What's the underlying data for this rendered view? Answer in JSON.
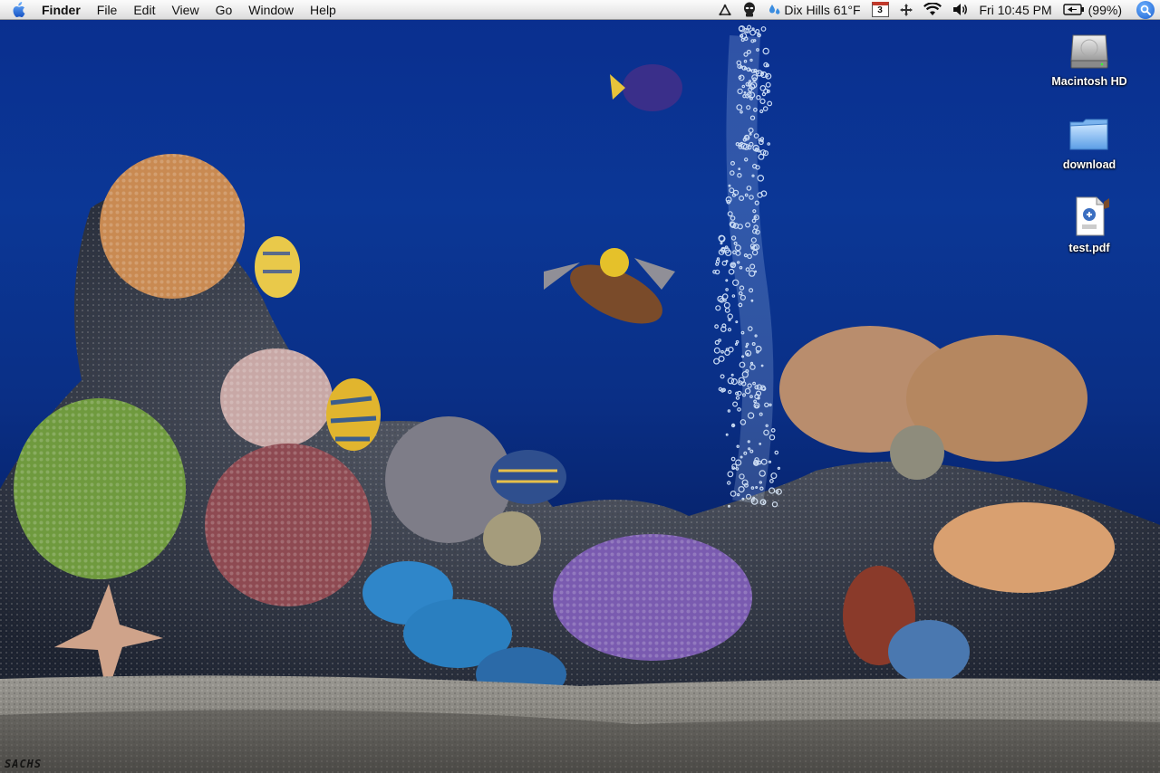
{
  "menubar": {
    "app_name": "Finder",
    "menus": [
      "File",
      "Edit",
      "View",
      "Go",
      "Window",
      "Help"
    ],
    "status": {
      "weather": "Dix Hills 61°F",
      "calendar_day": "3",
      "clock": "Fri 10:45 PM",
      "battery": "(99%)"
    },
    "icons": [
      "apple-menu-icon",
      "network-icon",
      "alien-icon",
      "weather-drops-icon",
      "calendar-icon",
      "move-icon",
      "wifi-icon",
      "volume-icon",
      "battery-icon",
      "spotlight-icon"
    ]
  },
  "desktop": {
    "icons": [
      {
        "label": "Macintosh HD",
        "type": "hard-drive"
      },
      {
        "label": "download",
        "type": "folder"
      },
      {
        "label": "test.pdf",
        "type": "pdf"
      }
    ],
    "signature": "SACHS"
  },
  "colors": {
    "water_top": "#0b3796",
    "water_bottom": "#03154a",
    "sand": "#7c7c78",
    "menubar": "#ececec"
  }
}
